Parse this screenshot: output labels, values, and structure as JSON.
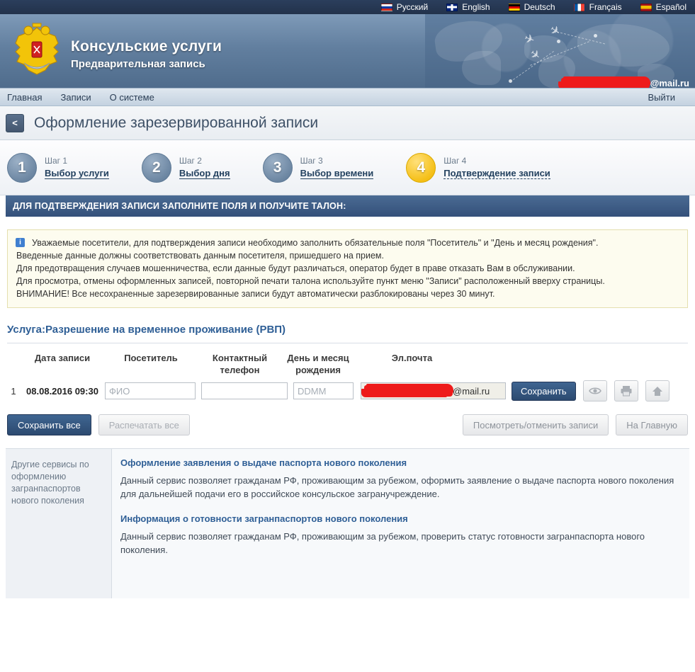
{
  "langbar": {
    "items": [
      {
        "label": "Русский",
        "flag": "flag-ru",
        "icon": "flag-russia-icon"
      },
      {
        "label": "English",
        "flag": "flag-gb",
        "icon": "flag-uk-icon"
      },
      {
        "label": "Deutsch",
        "flag": "flag-de",
        "icon": "flag-germany-icon"
      },
      {
        "label": "Français",
        "flag": "flag-fr",
        "icon": "flag-france-icon"
      },
      {
        "label": "Español",
        "flag": "flag-es",
        "icon": "flag-spain-icon"
      }
    ]
  },
  "header": {
    "emblem_icon": "russian-coat-of-arms-icon",
    "title": "Консульские услуги",
    "subtitle": "Предварительная запись",
    "user_email_suffix": "@mail.ru"
  },
  "nav": {
    "items": [
      "Главная",
      "Записи",
      "О системе"
    ],
    "logout": "Выйти"
  },
  "page": {
    "back_label": "<",
    "title": "Оформление зарезервированной записи"
  },
  "steps": [
    {
      "num": "1",
      "num_label": "Шаг 1",
      "label": "Выбор услуги",
      "active": false
    },
    {
      "num": "2",
      "num_label": "Шаг 2",
      "label": "Выбор дня",
      "active": false
    },
    {
      "num": "3",
      "num_label": "Шаг 3",
      "label": "Выбор времени",
      "active": false
    },
    {
      "num": "4",
      "num_label": "Шаг 4",
      "label": "Подтверждение записи",
      "active": true
    }
  ],
  "banner": {
    "text": "ДЛЯ ПОДТВЕРЖДЕНИЯ ЗАПИСИ ЗАПОЛНИТЕ ПОЛЯ И ПОЛУЧИТЕ ТАЛОН:"
  },
  "info": {
    "icon": "info-icon",
    "icon_char": "i",
    "lines": [
      "Уважаемые посетители, для подтверждения записи необходимо заполнить обязательные поля \"Посетитель\" и \"День и месяц рождения\".",
      "Введенные данные должны соответствовать данным посетителя, пришедшего на прием.",
      "Для предотвращения случаев мошенничества, если данные будут различаться, оператор будет в праве отказать Вам в обслуживании.",
      "Для просмотра, отмены оформленных записей, повторной печати талона используйте пункт меню \"Записи\" расположенный вверху страницы.",
      "ВНИМАНИЕ! Все несохраненные зарезервированные записи будут автоматически разблокированы через 30 минут."
    ]
  },
  "service": {
    "title": "Услуга:Разрешение на временное проживание (РВП)"
  },
  "table": {
    "headers": {
      "index": "",
      "date": "Дата записи",
      "visitor": "Посетитель",
      "phone_line1": "Контактный",
      "phone_line2": "телефон",
      "birth_line1": "День и месяц",
      "birth_line2": "рождения",
      "email": "Эл.почта"
    },
    "row": {
      "index": "1",
      "date": "08.08.2016 09:30",
      "visitor_value": "",
      "visitor_placeholder": "ФИО",
      "phone_value": "",
      "phone_placeholder": "",
      "birth_value": "",
      "birth_placeholder": "DDMM",
      "email_suffix": "@mail.ru",
      "save_label": "Сохранить",
      "icon_buttons": [
        {
          "name": "view-icon",
          "title": "Посмотреть"
        },
        {
          "name": "print-icon",
          "title": "Печать"
        },
        {
          "name": "home-icon",
          "title": "На главную"
        }
      ]
    }
  },
  "actions": {
    "save_all": "Сохранить все",
    "print_all": "Распечатать все",
    "view_cancel": "Посмотреть/отменить записи",
    "home": "На Главную"
  },
  "footer": {
    "side_text": "Другие сервисы по оформлению загранпаспортов нового поколения",
    "services": [
      {
        "title": "Оформление заявления о выдаче паспорта нового поколения",
        "text": "Данный сервис позволяет гражданам РФ, проживающим за рубежом, оформить заявление о выдаче паспорта нового поколения для дальнейшей подачи его в российское консульское загранучреждение."
      },
      {
        "title": "Информация о готовности загранпаспортов нового поколения",
        "text": "Данный сервис позволяет гражданам РФ, проживающим за рубежом, проверить статус готовности загранпаспорта нового поколения."
      }
    ]
  }
}
